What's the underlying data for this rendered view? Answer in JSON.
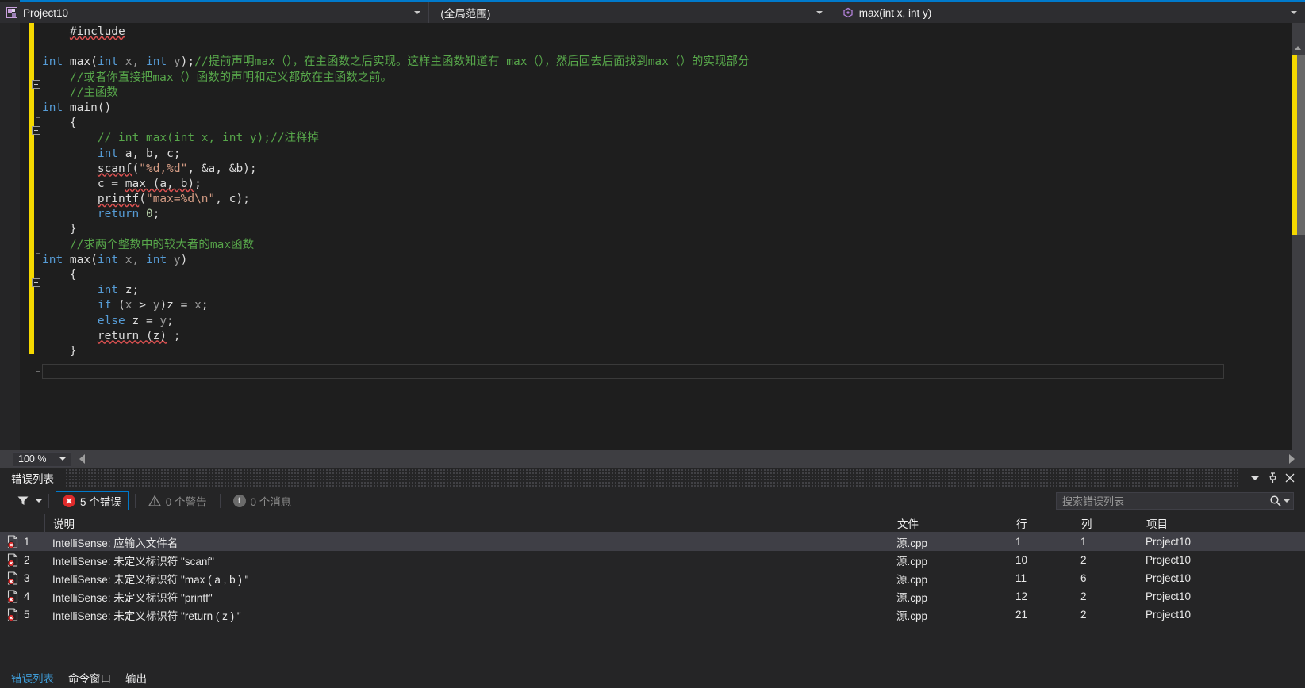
{
  "navbar": {
    "project_label": "Project10",
    "project_icon": "project-file-icon",
    "scope_label": "(全局范围)",
    "member_label": "max(int x, int y)",
    "member_icon": "method-icon",
    "caret_icon": "chevron-down-icon"
  },
  "editor": {
    "zoom_level": "100 %",
    "code_lines": [
      {
        "indent": 1,
        "fold": "",
        "segments": [
          {
            "t": "#include",
            "c": "pl sq2"
          }
        ]
      },
      {
        "indent": 0,
        "fold": "",
        "segments": []
      },
      {
        "indent": 0,
        "fold": "open",
        "segments": [
          {
            "t": "int",
            "c": "kw"
          },
          {
            "t": " max(",
            "c": "pl"
          },
          {
            "t": "int",
            "c": "kw"
          },
          {
            "t": " x, ",
            "c": "param"
          },
          {
            "t": "int",
            "c": "kw"
          },
          {
            "t": " y",
            "c": "param"
          },
          {
            "t": ");",
            "c": "pl"
          },
          {
            "t": "//提前声明max（），在主函数之后实现。这样主函数知道有 max（），然后回去后面找到max（）的实现部分",
            "c": "cm"
          }
        ]
      },
      {
        "indent": 1,
        "fold": "",
        "segments": [
          {
            "t": "//或者你直接把max（）函数的声明和定义都放在主函数之前。",
            "c": "cm"
          }
        ]
      },
      {
        "indent": 1,
        "fold": "",
        "segments": [
          {
            "t": "//主函数",
            "c": "cm"
          }
        ]
      },
      {
        "indent": 0,
        "fold": "open",
        "segments": [
          {
            "t": "int",
            "c": "kw"
          },
          {
            "t": " main()",
            "c": "pl"
          }
        ]
      },
      {
        "indent": 1,
        "fold": "",
        "segments": [
          {
            "t": "{",
            "c": "pl"
          }
        ]
      },
      {
        "indent": 2,
        "fold": "",
        "segments": [
          {
            "t": "// int max(int x, int y);//注释掉",
            "c": "cm"
          }
        ]
      },
      {
        "indent": 2,
        "fold": "",
        "segments": [
          {
            "t": "int",
            "c": "kw"
          },
          {
            "t": " a, b, c;",
            "c": "pl"
          }
        ]
      },
      {
        "indent": 2,
        "fold": "",
        "segments": [
          {
            "t": "scanf",
            "c": "pl sq2"
          },
          {
            "t": "(",
            "c": "pl"
          },
          {
            "t": "\"%d,%d\"",
            "c": "str"
          },
          {
            "t": ", &a, &b);",
            "c": "pl"
          }
        ]
      },
      {
        "indent": 2,
        "fold": "",
        "segments": [
          {
            "t": "c = ",
            "c": "pl"
          },
          {
            "t": "max (a, b)",
            "c": "pl sq2"
          },
          {
            "t": ";",
            "c": "pl"
          }
        ]
      },
      {
        "indent": 2,
        "fold": "",
        "segments": [
          {
            "t": "printf",
            "c": "pl sq2"
          },
          {
            "t": "(",
            "c": "pl"
          },
          {
            "t": "\"max=%d\\n\"",
            "c": "str"
          },
          {
            "t": ", c);",
            "c": "pl"
          }
        ]
      },
      {
        "indent": 2,
        "fold": "",
        "segments": [
          {
            "t": "return",
            "c": "kw"
          },
          {
            "t": " ",
            "c": "pl"
          },
          {
            "t": "0",
            "c": "num"
          },
          {
            "t": ";",
            "c": "pl"
          }
        ]
      },
      {
        "indent": 1,
        "fold": "close",
        "segments": [
          {
            "t": "}",
            "c": "pl"
          }
        ]
      },
      {
        "indent": 1,
        "fold": "",
        "segments": [
          {
            "t": "//求两个整数中的较大者的max函数",
            "c": "cm"
          }
        ]
      },
      {
        "indent": 0,
        "fold": "open",
        "segments": [
          {
            "t": "int",
            "c": "kw"
          },
          {
            "t": " max(",
            "c": "pl"
          },
          {
            "t": "int",
            "c": "kw"
          },
          {
            "t": " x, ",
            "c": "param"
          },
          {
            "t": "int",
            "c": "kw"
          },
          {
            "t": " y",
            "c": "param"
          },
          {
            "t": ")",
            "c": "pl"
          }
        ]
      },
      {
        "indent": 1,
        "fold": "",
        "segments": [
          {
            "t": "{",
            "c": "pl"
          }
        ]
      },
      {
        "indent": 2,
        "fold": "",
        "segments": [
          {
            "t": "int",
            "c": "kw"
          },
          {
            "t": " z;",
            "c": "pl"
          }
        ]
      },
      {
        "indent": 2,
        "fold": "",
        "segments": [
          {
            "t": "if",
            "c": "kw"
          },
          {
            "t": " (",
            "c": "pl"
          },
          {
            "t": "x",
            "c": "param"
          },
          {
            "t": " > ",
            "c": "pl"
          },
          {
            "t": "y",
            "c": "param"
          },
          {
            "t": ")z = ",
            "c": "pl"
          },
          {
            "t": "x",
            "c": "param"
          },
          {
            "t": ";",
            "c": "pl"
          }
        ]
      },
      {
        "indent": 2,
        "fold": "",
        "segments": [
          {
            "t": "else",
            "c": "kw"
          },
          {
            "t": " z = ",
            "c": "pl"
          },
          {
            "t": "y",
            "c": "param"
          },
          {
            "t": ";",
            "c": "pl"
          }
        ]
      },
      {
        "indent": 2,
        "fold": "",
        "segments": [
          {
            "t": "return (z)",
            "c": "pl sq2"
          },
          {
            "t": " ;",
            "c": "pl"
          }
        ]
      },
      {
        "indent": 1,
        "fold": "close",
        "segments": [
          {
            "t": "}",
            "c": "pl"
          }
        ]
      }
    ]
  },
  "error_panel": {
    "title": "错误列表",
    "toolbar": {
      "filter_icon": "filter-icon",
      "errors_label": "5 个错误",
      "warnings_label": "0 个警告",
      "messages_label": "0 个消息",
      "error_icon": "error-circle-icon",
      "warning_icon": "warning-triangle-icon",
      "info_icon": "info-circle-icon"
    },
    "search_placeholder": "搜索错误列表",
    "search_value": "",
    "search_icon": "magnifier-icon",
    "header_buttons": {
      "dropdown_icon": "chevron-down-icon",
      "pin_icon": "pin-icon",
      "close_icon": "close-icon"
    },
    "columns": [
      "",
      "",
      "说明",
      "文件",
      "行",
      "列",
      "项目"
    ],
    "rows": [
      {
        "num": "1",
        "desc": "IntelliSense: 应输入文件名",
        "file": "源.cpp",
        "line": "1",
        "col": "1",
        "project": "Project10",
        "selected": true
      },
      {
        "num": "2",
        "desc": "IntelliSense: 未定义标识符 \"scanf\"",
        "file": "源.cpp",
        "line": "10",
        "col": "2",
        "project": "Project10",
        "selected": false
      },
      {
        "num": "3",
        "desc": "IntelliSense: 未定义标识符 \"max ( a , b ) \"",
        "file": "源.cpp",
        "line": "11",
        "col": "6",
        "project": "Project10",
        "selected": false
      },
      {
        "num": "4",
        "desc": "IntelliSense: 未定义标识符 \"printf\"",
        "file": "源.cpp",
        "line": "12",
        "col": "2",
        "project": "Project10",
        "selected": false
      },
      {
        "num": "5",
        "desc": "IntelliSense: 未定义标识符 \"return ( z ) \"",
        "file": "源.cpp",
        "line": "21",
        "col": "2",
        "project": "Project10",
        "selected": false
      }
    ],
    "tabs": [
      {
        "label": "错误列表",
        "active": true
      },
      {
        "label": "命令窗口",
        "active": false
      },
      {
        "label": "输出",
        "active": false
      }
    ]
  },
  "colors": {
    "accent": "#007acc",
    "editor_bg": "#1e1e1e",
    "chrome_bg": "#2d2d30",
    "panel_bg": "#252526",
    "change_bar": "#f5d800",
    "error_red": "#e02b2b",
    "comment_green": "#57a64a",
    "keyword_blue": "#569cd6",
    "string_orange": "#d69d85"
  }
}
